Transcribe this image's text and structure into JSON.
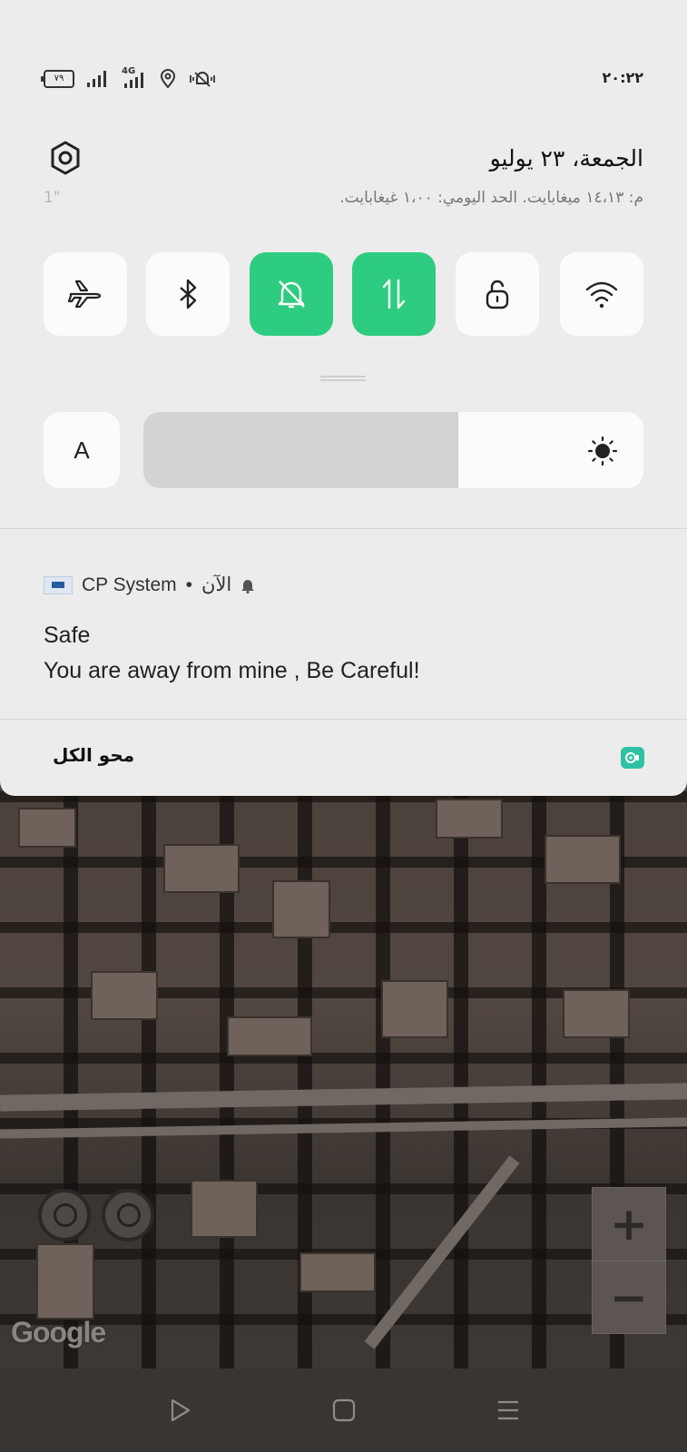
{
  "status_bar": {
    "time": "٢٠:٢٢",
    "battery": "٧٩",
    "network": "4G"
  },
  "header": {
    "date": "الجمعة، ٢٣ يوليو",
    "data_usage": "م: ١٤،١٣ ميغابايت. الحد اليومي: ١،٠٠ غيغابايت.",
    "data_usage_faded": "1\""
  },
  "quick_tiles": [
    {
      "name": "airplane",
      "icon": "airplane-icon",
      "active": false
    },
    {
      "name": "bluetooth",
      "icon": "bluetooth-icon",
      "active": false
    },
    {
      "name": "silent",
      "icon": "bell-off-icon",
      "active": true
    },
    {
      "name": "mobile-data",
      "icon": "data-arrows-icon",
      "active": true
    },
    {
      "name": "rotation-lock",
      "icon": "lock-icon",
      "active": false
    },
    {
      "name": "wifi",
      "icon": "wifi-icon",
      "active": false
    }
  ],
  "brightness": {
    "auto_label": "A",
    "level": 0.63
  },
  "notification": {
    "app_name": "CP System",
    "time": "الآن",
    "title": "Safe",
    "body": "You are away from mine , Be Careful!"
  },
  "footer": {
    "clear_all": "محو الكل"
  },
  "map": {
    "attribution": "Google",
    "zoom_in": "+",
    "zoom_out": "−"
  },
  "colors": {
    "accent": "#2ecc80",
    "shade_bg": "#ececec",
    "tile_bg": "#fbfbfb",
    "screen_record": "#2fc1a3"
  }
}
